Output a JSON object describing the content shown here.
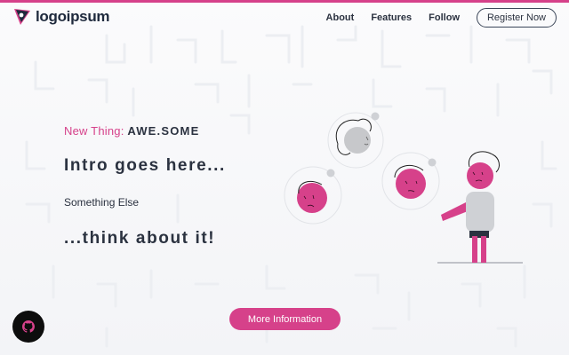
{
  "brand": {
    "logo_text": "logoipsum",
    "accent_color": "#d6418a",
    "dark_color": "#2b3240"
  },
  "nav": {
    "links": [
      {
        "label": "About"
      },
      {
        "label": "Features"
      },
      {
        "label": "Follow"
      }
    ],
    "register_label": "Register Now"
  },
  "hero": {
    "kicker_prefix": "New Thing:",
    "kicker_emphasis": "AWE.SOME",
    "intro": "Intro goes here...",
    "subtext": "Something Else",
    "tagline": "...think about it!",
    "illustration": "person-with-emotion-bubbles-illustration"
  },
  "cta": {
    "label": "More Information"
  },
  "floating": {
    "icon": "github-icon"
  }
}
